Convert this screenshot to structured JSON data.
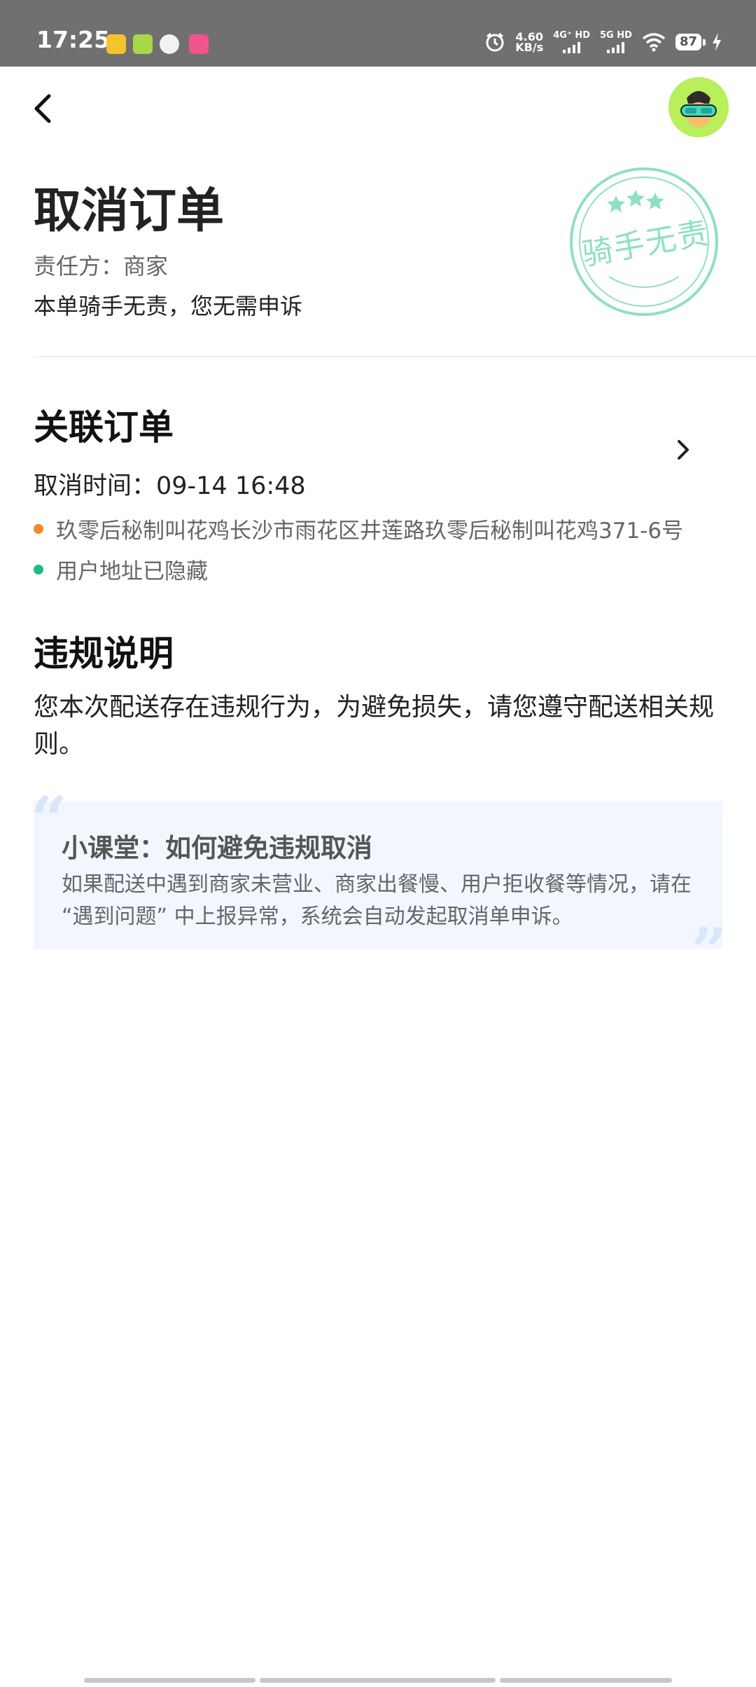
{
  "status_bar": {
    "time": "17:25",
    "net_speed_value": "4.60",
    "net_speed_unit": "KB/s",
    "sim1_label": "4G⁺ HD",
    "sim2_label": "5G HD",
    "battery": "87",
    "icons": [
      "alarm-icon",
      "wifi-icon",
      "charging-icon"
    ]
  },
  "header": {
    "back_icon": "chevron-left-icon",
    "avatar_icon": "rider-avatar-icon"
  },
  "title": "取消订单",
  "responsibility": "责任方：商家",
  "notice": "本单骑手无责，您无需申诉",
  "stamp": {
    "text": "骑手无责",
    "color": "#8fe0c2"
  },
  "related_order": {
    "section_title": "关联订单",
    "cancel_time": "取消时间：09-14 16:48",
    "merchant_address": "玖零后秘制叫花鸡长沙市雨花区井莲路玖零后秘制叫花鸡371-6号",
    "user_address": "用户地址已隐藏",
    "merchant_dot_color": "#f2892f",
    "user_dot_color": "#1dbd7f"
  },
  "violation": {
    "section_title": "违规说明",
    "description": "您本次配送存在违规行为，为避免损失，请您遵守配送相关规则。"
  },
  "tip": {
    "title": "小课堂：如何避免违规取消",
    "body": "如果配送中遇到商家未营业、商家出餐慢、用户拒收餐等情况，请在 “遇到问题” 中上报异常，系统会自动发起取消单申诉。"
  }
}
